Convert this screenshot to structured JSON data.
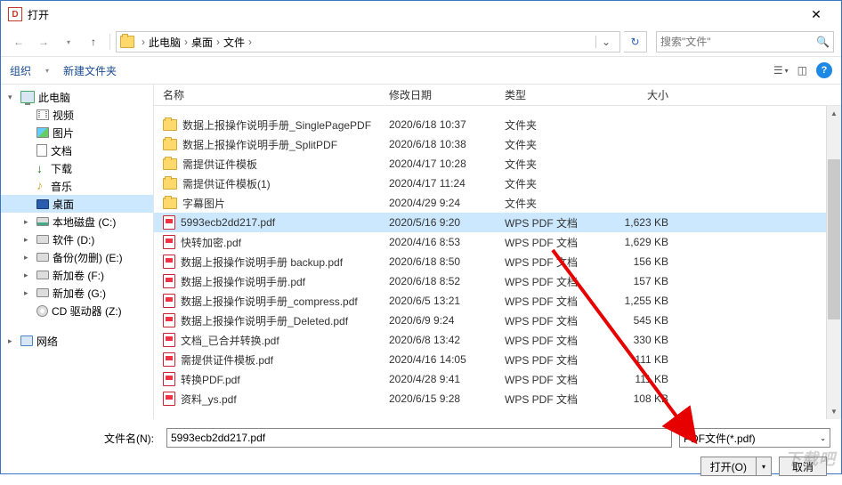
{
  "window": {
    "title": "打开"
  },
  "breadcrumb": {
    "items": [
      "此电脑",
      "桌面",
      "文件"
    ]
  },
  "search": {
    "placeholder": "搜索\"文件\""
  },
  "toolbar": {
    "organize": "组织",
    "newfolder": "新建文件夹"
  },
  "sidebar": [
    {
      "label": "此电脑",
      "icon": "pc",
      "arrow": "▾",
      "indent": 0
    },
    {
      "label": "视频",
      "icon": "video",
      "indent": 1
    },
    {
      "label": "图片",
      "icon": "pic",
      "indent": 1
    },
    {
      "label": "文档",
      "icon": "doc",
      "indent": 1
    },
    {
      "label": "下载",
      "icon": "download",
      "indent": 1
    },
    {
      "label": "音乐",
      "icon": "music",
      "indent": 1
    },
    {
      "label": "桌面",
      "icon": "desktop",
      "indent": 1,
      "selected": true
    },
    {
      "label": "本地磁盘 (C:)",
      "icon": "disk c",
      "arrow": "▸",
      "indent": 1
    },
    {
      "label": "软件 (D:)",
      "icon": "disk",
      "arrow": "▸",
      "indent": 1
    },
    {
      "label": "备份(勿删) (E:)",
      "icon": "disk",
      "arrow": "▸",
      "indent": 1
    },
    {
      "label": "新加卷 (F:)",
      "icon": "disk",
      "arrow": "▸",
      "indent": 1
    },
    {
      "label": "新加卷 (G:)",
      "icon": "disk",
      "arrow": "▸",
      "indent": 1
    },
    {
      "label": "CD 驱动器 (Z:)",
      "icon": "cd",
      "indent": 1
    },
    {
      "label": "网络",
      "icon": "network",
      "arrow": "▸",
      "indent": 0,
      "gap": true
    }
  ],
  "columns": {
    "name": "名称",
    "date": "修改日期",
    "type": "类型",
    "size": "大小"
  },
  "files": [
    {
      "icon": "folder",
      "name": "数据上报操作说明手册_SinglePagePDF",
      "date": "2020/6/18 10:37",
      "type": "文件夹",
      "size": ""
    },
    {
      "icon": "folder",
      "name": "数据上报操作说明手册_SplitPDF",
      "date": "2020/6/18 10:38",
      "type": "文件夹",
      "size": ""
    },
    {
      "icon": "folder",
      "name": "需提供证件模板",
      "date": "2020/4/17 10:28",
      "type": "文件夹",
      "size": ""
    },
    {
      "icon": "folder",
      "name": "需提供证件模板(1)",
      "date": "2020/4/17 11:24",
      "type": "文件夹",
      "size": ""
    },
    {
      "icon": "folder",
      "name": "字幕图片",
      "date": "2020/4/29 9:24",
      "type": "文件夹",
      "size": ""
    },
    {
      "icon": "pdf",
      "name": "5993ecb2dd217.pdf",
      "date": "2020/5/16 9:20",
      "type": "WPS PDF 文档",
      "size": "1,623 KB",
      "selected": true
    },
    {
      "icon": "pdf",
      "name": "快转加密.pdf",
      "date": "2020/4/16 8:53",
      "type": "WPS PDF 文档",
      "size": "1,629 KB"
    },
    {
      "icon": "pdf",
      "name": "数据上报操作说明手册 backup.pdf",
      "date": "2020/6/18 8:50",
      "type": "WPS PDF 文档",
      "size": "156 KB"
    },
    {
      "icon": "pdf",
      "name": "数据上报操作说明手册.pdf",
      "date": "2020/6/18 8:52",
      "type": "WPS PDF 文档",
      "size": "157 KB"
    },
    {
      "icon": "pdf",
      "name": "数据上报操作说明手册_compress.pdf",
      "date": "2020/6/5 13:21",
      "type": "WPS PDF 文档",
      "size": "1,255 KB"
    },
    {
      "icon": "pdf",
      "name": "数据上报操作说明手册_Deleted.pdf",
      "date": "2020/6/9 9:24",
      "type": "WPS PDF 文档",
      "size": "545 KB"
    },
    {
      "icon": "pdf",
      "name": "文档_已合并转换.pdf",
      "date": "2020/6/8 13:42",
      "type": "WPS PDF 文档",
      "size": "330 KB"
    },
    {
      "icon": "pdf",
      "name": "需提供证件模板.pdf",
      "date": "2020/4/16 14:05",
      "type": "WPS PDF 文档",
      "size": "111 KB"
    },
    {
      "icon": "pdf",
      "name": "转换PDF.pdf",
      "date": "2020/4/28 9:41",
      "type": "WPS PDF 文档",
      "size": "111 KB"
    },
    {
      "icon": "pdf",
      "name": "资料_ys.pdf",
      "date": "2020/6/15 9:28",
      "type": "WPS PDF 文档",
      "size": "108 KB"
    }
  ],
  "filename": {
    "label": "文件名(N):",
    "value": "5993ecb2dd217.pdf"
  },
  "filter": {
    "label": "PDF文件(*.pdf)"
  },
  "buttons": {
    "open": "打开(O)",
    "cancel": "取消"
  },
  "watermark": "下载吧"
}
